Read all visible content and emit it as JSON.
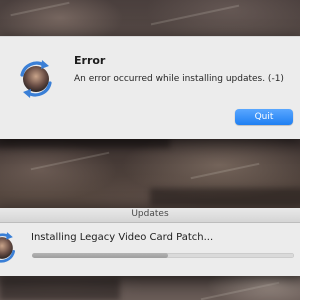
{
  "error_dialog": {
    "title": "Error",
    "message": "An error occurred while installing updates. (-1)",
    "quit_label": "Quit",
    "icon": "software-update-icon"
  },
  "updates_window": {
    "title": "Updates",
    "status": "Installing Legacy Video Card Patch...",
    "progress_fraction": 0.52,
    "icon": "software-update-icon"
  },
  "colors": {
    "accent": "#1f7ff2",
    "dialog_background": "#ececec"
  }
}
